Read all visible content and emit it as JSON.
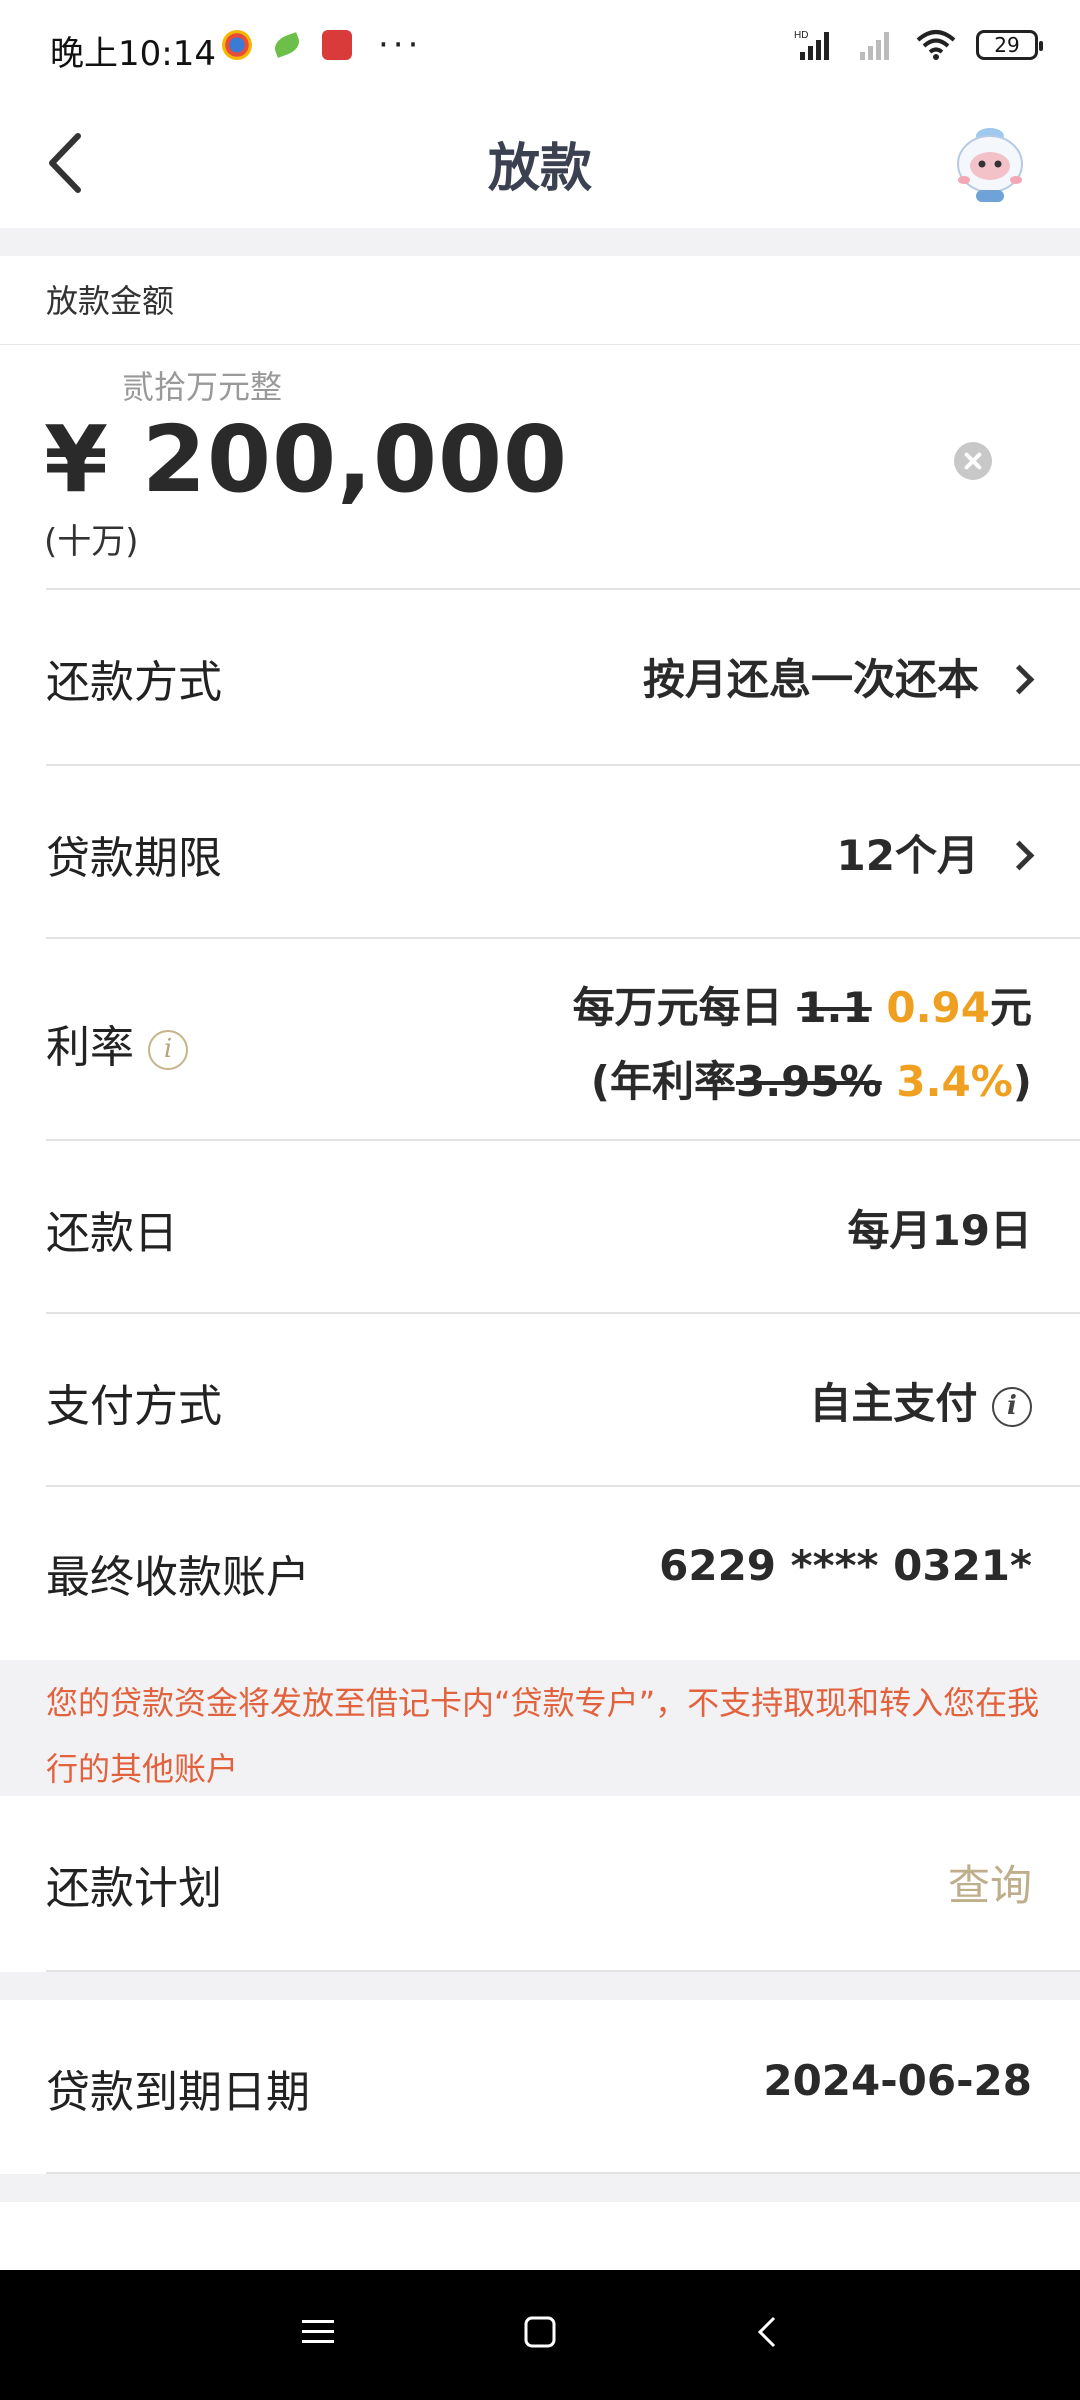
{
  "status_bar": {
    "time": "晚上10:14",
    "more": "···",
    "battery": "29"
  },
  "nav": {
    "title": "放款"
  },
  "amount": {
    "section_label": "放款金额",
    "in_words": "贰拾万元整",
    "value": "¥ 200,000",
    "hint": "(十万)"
  },
  "rows": {
    "repay_method": {
      "label": "还款方式",
      "value": "按月还息一次还本"
    },
    "loan_term": {
      "label": "贷款期限",
      "value": "12个月"
    },
    "rate": {
      "label": "利率",
      "line1_prefix": "每万元每日",
      "line1_old": "1.1",
      "line1_new": "0.94",
      "line1_suffix": "元",
      "line2_prefix": "(年利率",
      "line2_old": "3.95%",
      "line2_new": "3.4%",
      "line2_suffix": ")"
    },
    "repay_day": {
      "label": "还款日",
      "value": "每月19日"
    },
    "payment_method": {
      "label": "支付方式",
      "value": "自主支付"
    },
    "account": {
      "label": "最终收款账户",
      "value": "6229 **** 0321*"
    }
  },
  "notice": "您的贷款资金将发放至借记卡内“贷款专户”，不支持取现和转入您在我行的其他账户",
  "repay_plan": {
    "label": "还款计划",
    "action": "查询"
  },
  "due_date": {
    "label": "贷款到期日期",
    "value": "2024-06-28"
  },
  "colors": {
    "accent_orange": "#f0a021",
    "notice_red": "#e2623d",
    "link_gold": "#bfae8b",
    "title": "#3b4150"
  }
}
